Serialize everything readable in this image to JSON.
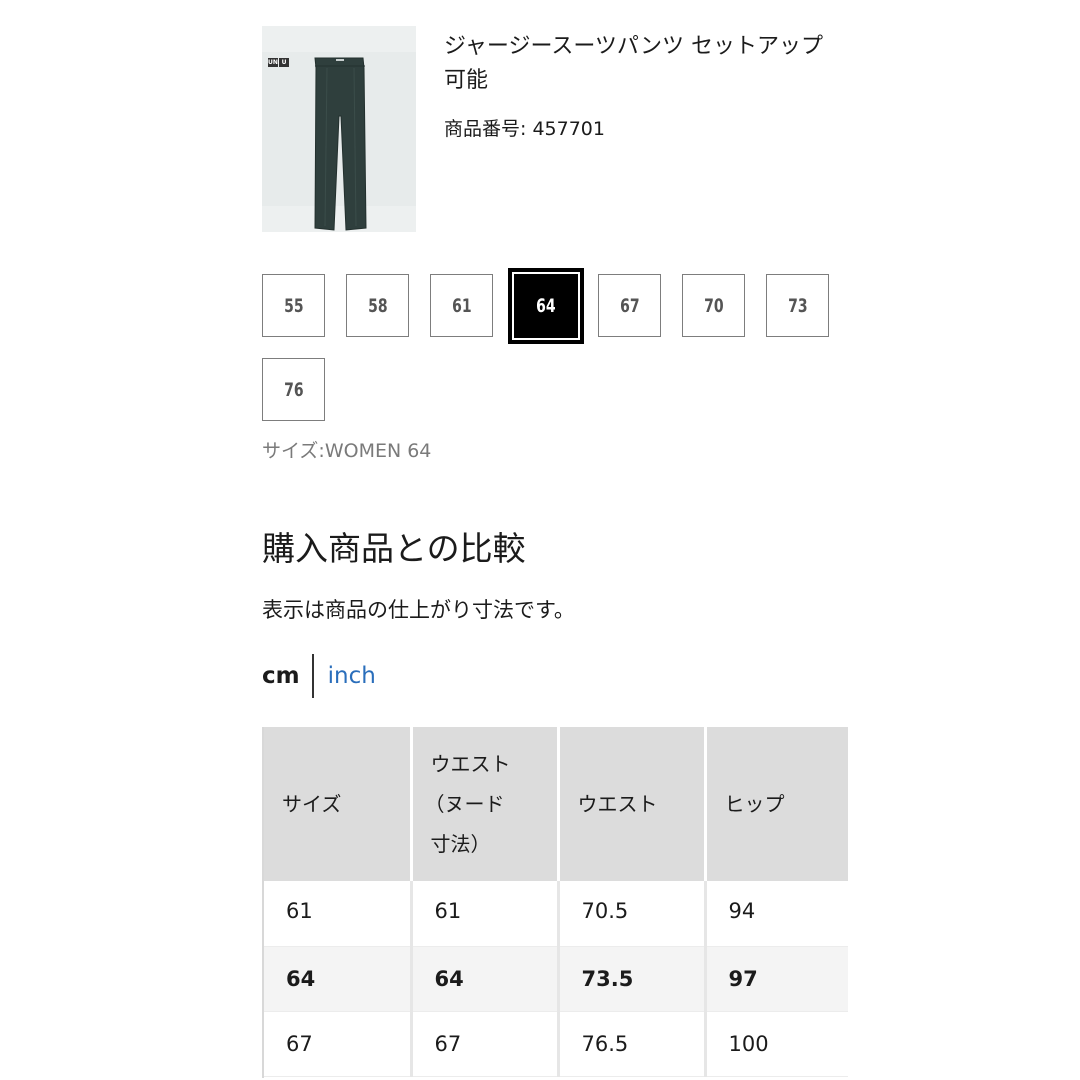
{
  "product": {
    "name_line1": "ジャージースーツパンツ セットアップ",
    "name_line2": "可能",
    "number": "商品番号: 457701",
    "logo": [
      "UNI",
      "U"
    ]
  },
  "sizes": {
    "options": [
      "55",
      "58",
      "61",
      "64",
      "67",
      "70",
      "73",
      "76"
    ],
    "selected": "64",
    "label": "サイズ:WOMEN 64"
  },
  "comparison": {
    "title": "購入商品との比較",
    "note": "表示は商品の仕上がり寸法です。",
    "units": {
      "cm": "cm",
      "inch": "inch",
      "active": "cm"
    },
    "table": {
      "headers": [
        "サイズ",
        "ウエスト（ヌード寸法）",
        "ウエスト",
        "ヒップ"
      ],
      "header_lines": [
        [
          "サイズ"
        ],
        [
          "ウエスト",
          "（ヌード",
          "寸法）"
        ],
        [
          "ウエスト"
        ],
        [
          "ヒップ"
        ]
      ],
      "rows": [
        {
          "cells": [
            "61",
            "61",
            "70.5",
            "94"
          ],
          "highlight": false
        },
        {
          "cells": [
            "64",
            "64",
            "73.5",
            "97"
          ],
          "highlight": true
        },
        {
          "cells": [
            "67",
            "67",
            "76.5",
            "100"
          ],
          "highlight": false
        }
      ]
    }
  },
  "colors": {
    "link": "#2a6ebb",
    "selected_bg": "#000000",
    "header_bg": "#dcdcdc",
    "product_color": "#2f3f3d"
  }
}
